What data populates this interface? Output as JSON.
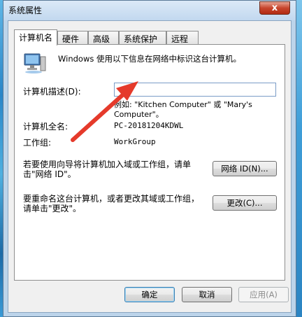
{
  "window": {
    "title": "系统属性",
    "close_symbol": "x"
  },
  "tabs": [
    {
      "label": "计算机名",
      "active": true
    },
    {
      "label": "硬件",
      "active": false
    },
    {
      "label": "高级",
      "active": false
    },
    {
      "label": "系统保护",
      "active": false
    },
    {
      "label": "远程",
      "active": false
    }
  ],
  "content": {
    "intro": "Windows 使用以下信息在网络中标识这台计算机。",
    "description_label": "计算机描述(D):",
    "description_value": "",
    "example_line1": "例如: \"Kitchen Computer\" 或 \"Mary's",
    "example_line2": "Computer\"。",
    "fullname_label": "计算机全名:",
    "fullname_value": "PC-20181204KDWL",
    "workgroup_label": "工作组:",
    "workgroup_value": "WorkGroup",
    "wizard_text_line1": "若要使用向导将计算机加入域或工作组，请单",
    "wizard_text_line2": "击\"网络 ID\"。",
    "network_id_button": "网络 ID(N)...",
    "rename_text_line1": "要重命名这台计算机，或者更改其域或工作组，",
    "rename_text_line2": "请单击\"更改\"。",
    "change_button": "更改(C)..."
  },
  "footer": {
    "ok_button": "确定",
    "cancel_button": "取消",
    "apply_button": "应用(A)"
  },
  "colors": {
    "annotation_arrow": "#e53a2b",
    "title_bar": "#c2d8ef",
    "close_button": "#c7452d"
  },
  "icons": {
    "computer": "computer-monitor-icon",
    "close": "close-icon"
  }
}
